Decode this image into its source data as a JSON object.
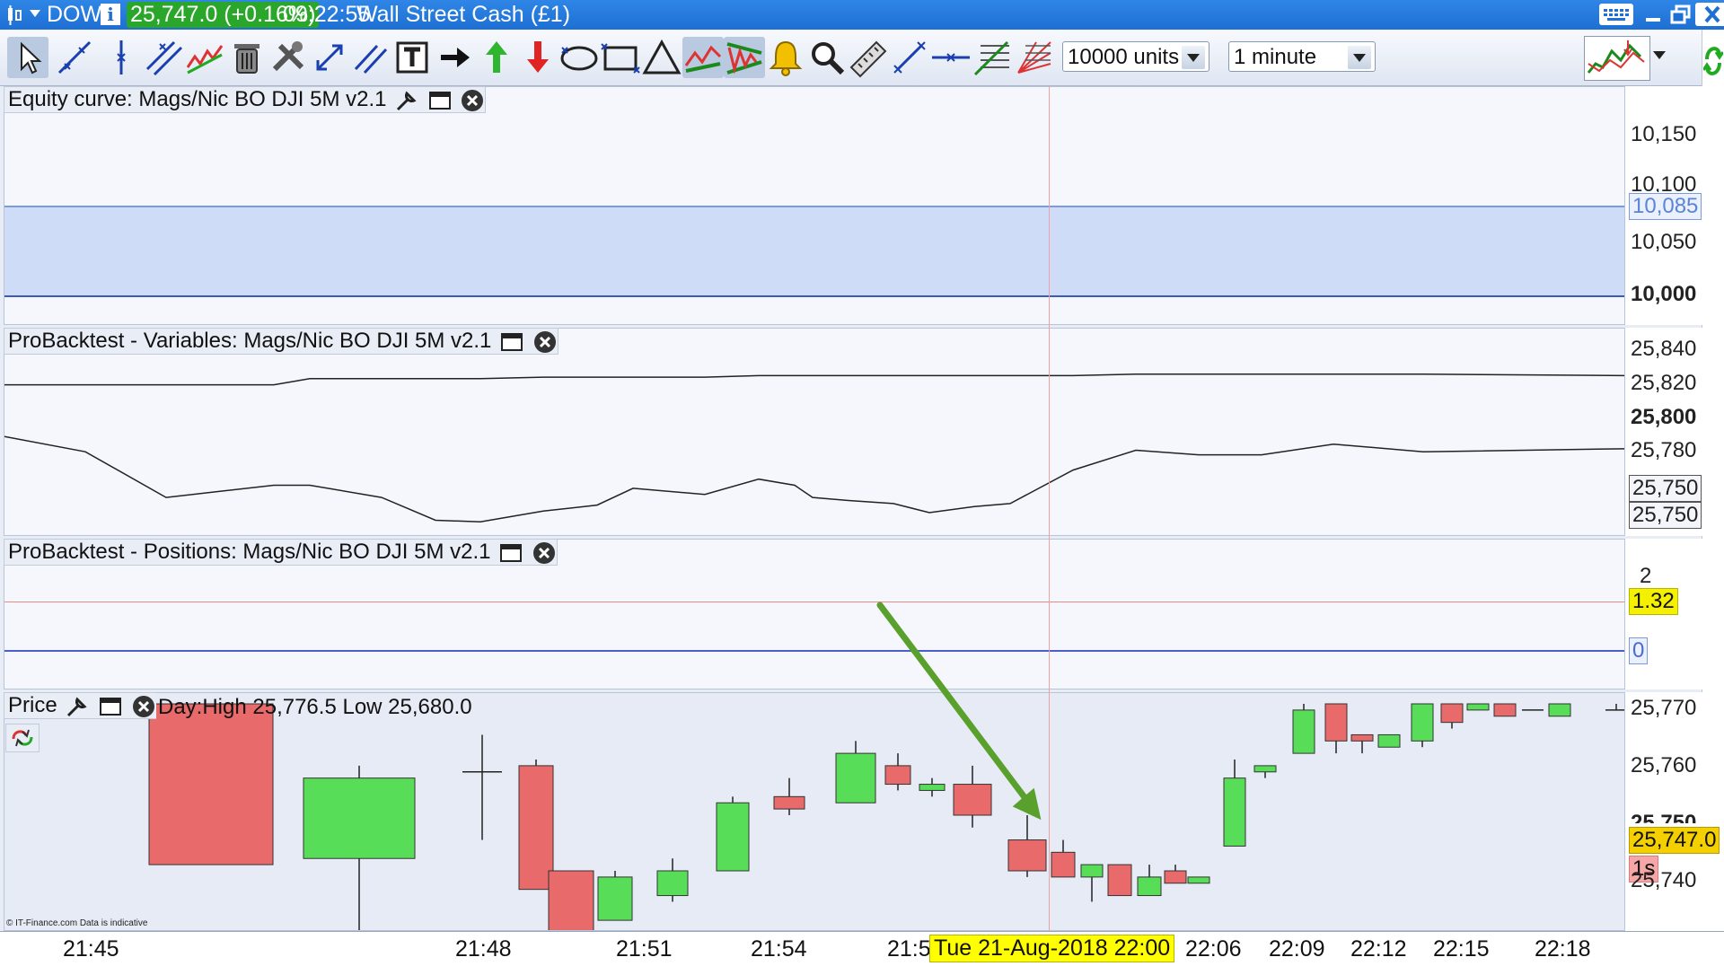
{
  "titlebar": {
    "instrument": "DOW",
    "price": "25,747.0 (+0.16%)",
    "time": "09:22:55",
    "market": "Wall Street Cash (£1)"
  },
  "toolbar": {
    "units": "10000 units",
    "timeframe": "1 minute",
    "tools": [
      "pointer-icon",
      "trendline-icon",
      "vertical-line-icon",
      "channel-icon",
      "zigzag-icon",
      "trash-icon",
      "tools-icon",
      "expand-icon",
      "parallel-icon",
      "text-icon",
      "black-arrow-icon",
      "green-up-arrow-icon",
      "red-down-arrow-icon",
      "ellipse-icon",
      "rectangle-icon",
      "triangle-icon",
      "zigzag-pattern-icon",
      "pennant-icon",
      "alert-bell-icon",
      "zoom-icon",
      "ruler-icon",
      "segment-icon",
      "horizontal-line-icon",
      "fibonacci-icon",
      "gann-fan-icon"
    ]
  },
  "equity_panel": {
    "label": "Equity curve: Mags/Nic BO DJI 5M v2.1",
    "axis": [
      "10,150",
      "10,100",
      "10,050"
    ],
    "axis_bold": "10,000",
    "tag": "10,085"
  },
  "variables_panel": {
    "label": "ProBacktest - Variables: Mags/Nic BO DJI 5M v2.1",
    "axis": [
      "25,840",
      "25,820",
      "25,780"
    ],
    "axis_bold": "25,800",
    "tag1": "25,750",
    "tag2": "25,750"
  },
  "positions_panel": {
    "label": "ProBacktest - Positions: Mags/Nic BO DJI 5M v2.1",
    "axis_top": "2",
    "tag_yellow": "1.32",
    "tag_zero": "0"
  },
  "price_panel": {
    "label": "Price",
    "dayinfo": "Day:High 25,776.5 Low 25,680.0",
    "axis": [
      "25,770",
      "25,760",
      "25,740"
    ],
    "axis_bold": "25,750",
    "last_price": "25,747.0",
    "countdown": "1s",
    "credit": "© IT-Finance.com  Data is indicative"
  },
  "time_axis": {
    "labels": [
      "21:45",
      "21:48",
      "21:51",
      "21:54",
      "21:5",
      "22:06",
      "22:09",
      "22:12",
      "22:15",
      "22:18"
    ],
    "crosshair_date": "Tue 21-Aug-2018 22:00"
  },
  "colors": {
    "bull": "#57dd57",
    "bear": "#e86a6a",
    "accent": "#1e6fd3",
    "arrow": "#5aa02c"
  },
  "chart_data": {
    "type": "candlestick",
    "title": "",
    "price_range": [
      25736,
      25772
    ],
    "candles": [
      {
        "o": 25772,
        "h": 25772,
        "l": 25746,
        "c": 25746
      },
      {
        "o": 25747,
        "h": 25762,
        "l": 25733,
        "c": 25760
      },
      {
        "o": 25761,
        "h": 25767,
        "l": 25750,
        "c": 25761
      },
      {
        "o": 25762,
        "h": 25763,
        "l": 25742,
        "c": 25742
      },
      {
        "o": 25745,
        "h": 25745,
        "l": 25734,
        "c": 25734
      },
      {
        "o": 25737,
        "h": 25745,
        "l": 25737,
        "c": 25744
      },
      {
        "o": 25741,
        "h": 25747,
        "l": 25740,
        "c": 25745
      },
      {
        "o": 25745,
        "h": 25757,
        "l": 25745,
        "c": 25756
      },
      {
        "o": 25757,
        "h": 25760,
        "l": 25754,
        "c": 25755
      },
      {
        "o": 25756,
        "h": 25766,
        "l": 25756,
        "c": 25764
      },
      {
        "o": 25762,
        "h": 25764,
        "l": 25758,
        "c": 25759
      },
      {
        "o": 25758,
        "h": 25760,
        "l": 25757,
        "c": 25759
      },
      {
        "o": 25759,
        "h": 25762,
        "l": 25752,
        "c": 25754
      },
      {
        "o": 25750,
        "h": 25754,
        "l": 25744,
        "c": 25745
      },
      {
        "o": 25748,
        "h": 25750,
        "l": 25744,
        "c": 25744
      },
      {
        "o": 25744,
        "h": 25746,
        "l": 25740,
        "c": 25746
      },
      {
        "o": 25746,
        "h": 25746,
        "l": 25741,
        "c": 25741
      },
      {
        "o": 25741,
        "h": 25746,
        "l": 25741,
        "c": 25744
      },
      {
        "o": 25745,
        "h": 25746,
        "l": 25743,
        "c": 25743
      },
      {
        "o": 25743,
        "h": 25744,
        "l": 25743,
        "c": 25744
      },
      {
        "o": 25749,
        "h": 25763,
        "l": 25749,
        "c": 25760
      },
      {
        "o": 25761,
        "h": 25762,
        "l": 25760,
        "c": 25762
      },
      {
        "o": 25764,
        "h": 25772,
        "l": 25764,
        "c": 25771
      },
      {
        "o": 25772,
        "h": 25772,
        "l": 25764,
        "c": 25766
      },
      {
        "o": 25767,
        "h": 25767,
        "l": 25764,
        "c": 25766
      },
      {
        "o": 25765,
        "h": 25767,
        "l": 25765,
        "c": 25767
      },
      {
        "o": 25766,
        "h": 25772,
        "l": 25765,
        "c": 25772
      },
      {
        "o": 25772,
        "h": 25772,
        "l": 25768,
        "c": 25769
      },
      {
        "o": 25771,
        "h": 25772,
        "l": 25771,
        "c": 25772
      },
      {
        "o": 25772,
        "h": 25772,
        "l": 25770,
        "c": 25770
      },
      {
        "o": 25771,
        "h": 25771,
        "l": 25771,
        "c": 25771
      },
      {
        "o": 25770,
        "h": 25772,
        "l": 25770,
        "c": 25772
      },
      {
        "o": 25771,
        "h": 25772,
        "l": 25771,
        "c": 25771
      }
    ],
    "variables_upper": [
      25814,
      25814,
      25814,
      25814,
      25814,
      25818,
      25818,
      25818,
      25818,
      25819,
      25819,
      25819,
      25819,
      25820,
      25820,
      25820,
      25820,
      25820,
      25820,
      25820,
      25820,
      25820,
      25821,
      25821,
      25821,
      25821,
      25821,
      25820
    ],
    "variables_lower": [
      25780,
      25770,
      25740,
      25744,
      25748,
      25748,
      25740,
      25725,
      25724,
      25731,
      25735,
      25746,
      25742,
      25752,
      25748,
      25740,
      25738,
      25736,
      25730,
      25734,
      25736,
      25758,
      25771,
      25768,
      25768,
      25775,
      25770,
      25772
    ]
  }
}
